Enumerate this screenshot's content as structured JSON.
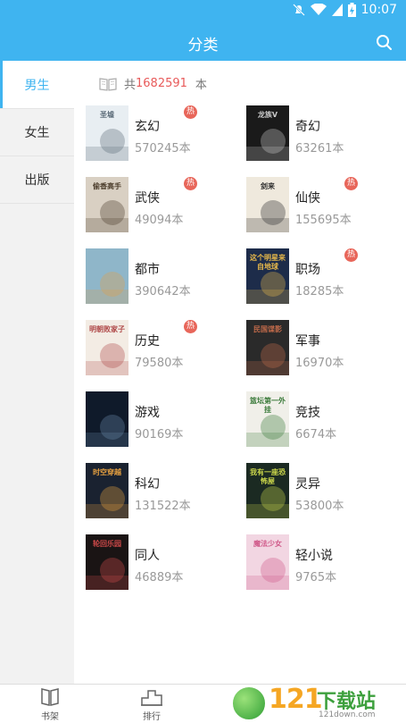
{
  "status_bar": {
    "time": "10:07"
  },
  "app_bar": {
    "title": "分类"
  },
  "sidebar": {
    "items": [
      {
        "label": "男生",
        "active": true
      },
      {
        "label": "女生",
        "active": false
      },
      {
        "label": "出版",
        "active": false
      }
    ]
  },
  "summary": {
    "prefix": "共",
    "count": "1682591",
    "unit": "本"
  },
  "hot_label": "热",
  "categories": [
    {
      "name": "玄幻",
      "count": "570245本",
      "hot": true,
      "cover_text": "圣墟"
    },
    {
      "name": "奇幻",
      "count": "63261本",
      "hot": false,
      "cover_text": "龙族Ⅴ"
    },
    {
      "name": "武侠",
      "count": "49094本",
      "hot": true,
      "cover_text": "偷香高手"
    },
    {
      "name": "仙侠",
      "count": "155695本",
      "hot": true,
      "cover_text": "剑来"
    },
    {
      "name": "都市",
      "count": "390642本",
      "hot": false,
      "cover_text": ""
    },
    {
      "name": "职场",
      "count": "18285本",
      "hot": true,
      "cover_text": "这个明星来自地球"
    },
    {
      "name": "历史",
      "count": "79580本",
      "hot": true,
      "cover_text": "明朝败家子"
    },
    {
      "name": "军事",
      "count": "16970本",
      "hot": false,
      "cover_text": "民国谍影"
    },
    {
      "name": "游戏",
      "count": "90169本",
      "hot": false,
      "cover_text": ""
    },
    {
      "name": "竞技",
      "count": "6674本",
      "hot": false,
      "cover_text": "篮坛第一外挂"
    },
    {
      "name": "科幻",
      "count": "131522本",
      "hot": false,
      "cover_text": "时空穿越"
    },
    {
      "name": "灵异",
      "count": "53800本",
      "hot": false,
      "cover_text": "我有一座恐怖屋"
    },
    {
      "name": "同人",
      "count": "46889本",
      "hot": false,
      "cover_text": "轮回乐园"
    },
    {
      "name": "轻小说",
      "count": "9765本",
      "hot": false,
      "cover_text": "魔法少女"
    }
  ],
  "bottom_tabs": [
    {
      "label": "书架",
      "icon": "bookshelf-icon"
    },
    {
      "label": "排行",
      "icon": "ranking-icon"
    }
  ],
  "watermark": {
    "number": "121",
    "text": "下载站",
    "url": "121down.com"
  },
  "colors": {
    "accent": "#3fb4f0",
    "hot": "#e8665a",
    "count_highlight": "#e85a5a"
  }
}
